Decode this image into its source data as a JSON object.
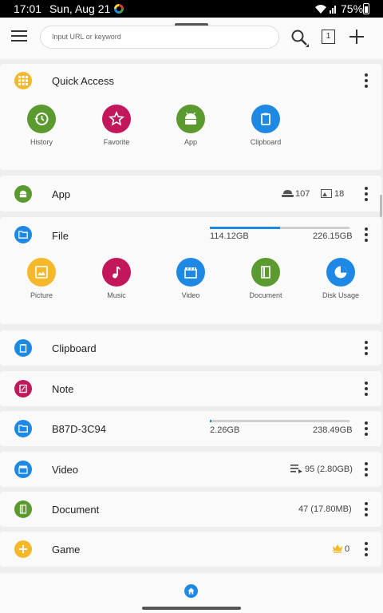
{
  "status_bar": {
    "time": "17:01",
    "date": "Sun, Aug 21",
    "battery": "75%"
  },
  "toolbar": {
    "url_placeholder": "Input URL or keyword",
    "tab_count": "1"
  },
  "quick_access": {
    "title": "Quick Access",
    "items": [
      {
        "label": "History",
        "color": "#5a9a2f"
      },
      {
        "label": "Favorite",
        "color": "#c2185b"
      },
      {
        "label": "App",
        "color": "#5a9a2f"
      },
      {
        "label": "Clipboard",
        "color": "#1e88e5"
      }
    ]
  },
  "app": {
    "label": "App",
    "user_apps": "107",
    "system_apps": "18"
  },
  "file": {
    "label": "File",
    "used": "114.12GB",
    "total": "226.15GB",
    "used_fraction": 0.505,
    "items": [
      {
        "label": "Picture",
        "color": "#f6b82b"
      },
      {
        "label": "Music",
        "color": "#c2185b"
      },
      {
        "label": "Video",
        "color": "#1e88e5"
      },
      {
        "label": "Document",
        "color": "#5a9a2f"
      },
      {
        "label": "Disk Usage",
        "color": "#1e88e5"
      }
    ]
  },
  "clipboard": {
    "label": "Clipboard"
  },
  "note": {
    "label": "Note"
  },
  "sd_card": {
    "label": "B87D-3C94",
    "used": "2.26GB",
    "total": "238.49GB",
    "used_fraction": 0.009
  },
  "video": {
    "label": "Video",
    "info": "95 (2.80GB)"
  },
  "document": {
    "label": "Document",
    "info": "47 (17.80MB)"
  },
  "game": {
    "label": "Game",
    "count": "0"
  },
  "colors": {
    "accent": "#1e88e5",
    "green": "#5a9a2f",
    "magenta": "#c2185b",
    "yellow": "#f6b82b"
  }
}
